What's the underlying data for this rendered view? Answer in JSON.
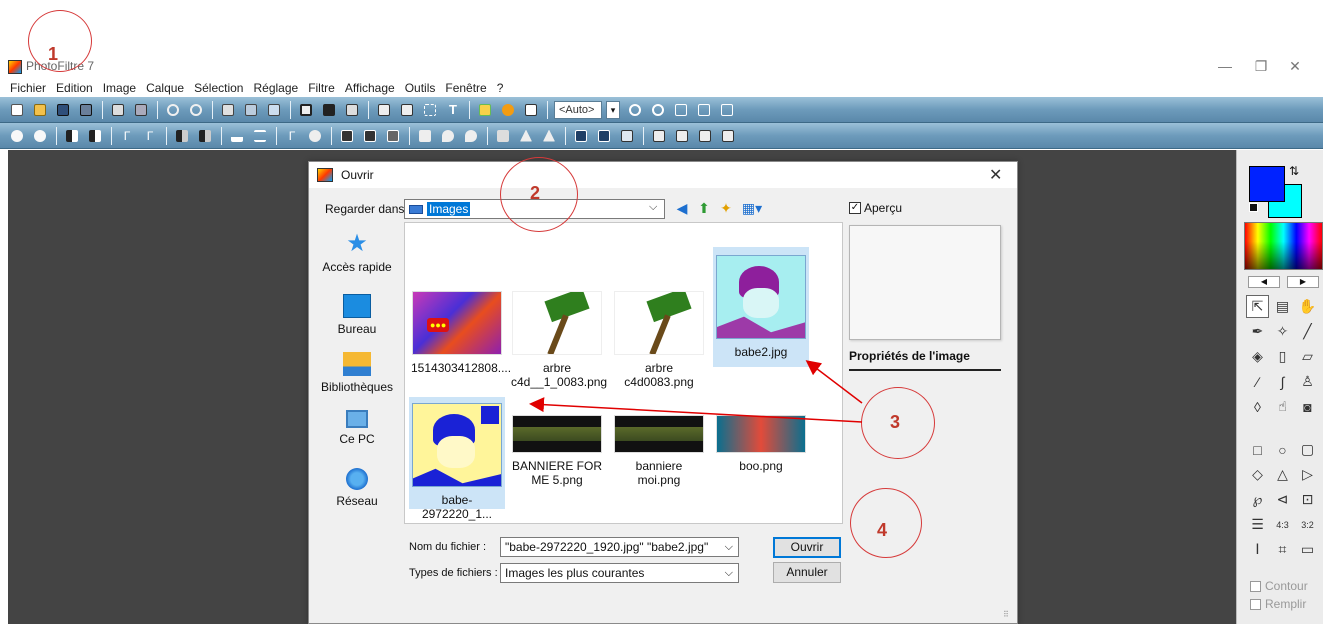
{
  "app": {
    "title": "PhotoFiltre 7",
    "controls": {
      "minimize": "—",
      "restore": "❐",
      "close": "✕"
    }
  },
  "menu": [
    "Fichier",
    "Edition",
    "Image",
    "Calque",
    "Sélection",
    "Réglage",
    "Filtre",
    "Affichage",
    "Outils",
    "Fenêtre",
    "?"
  ],
  "toolbar": {
    "zoom_value": "<Auto>",
    "zoom_drop": "▾"
  },
  "dialog": {
    "title": "Ouvrir",
    "close": "✕",
    "look_in_label": "Regarder dans :",
    "look_in_value": "Images",
    "places": [
      "Accès rapide",
      "Bureau",
      "Bibliothèques",
      "Ce PC",
      "Réseau"
    ],
    "files": [
      {
        "name": "1514303412808....",
        "selected": false,
        "thumb": "poster"
      },
      {
        "name": "arbre c4d__1_0083.png",
        "selected": false,
        "thumb": "tree"
      },
      {
        "name": "arbre c4d0083.png",
        "selected": false,
        "thumb": "tree"
      },
      {
        "name": "babe2.jpg",
        "selected": true,
        "thumb": "babe-purple"
      },
      {
        "name": "babe-2972220_1...",
        "selected": true,
        "thumb": "babe-yellow"
      },
      {
        "name": "BANNIERE FOR ME 5.png",
        "selected": false,
        "thumb": "banner"
      },
      {
        "name": "banniere moi.png",
        "selected": false,
        "thumb": "banner"
      },
      {
        "name": "boo.png",
        "selected": false,
        "thumb": "boo"
      }
    ],
    "preview_label": "Aperçu",
    "preview_checked": "✓",
    "properties_title": "Propriétés de l'image",
    "filename_label": "Nom du fichier :",
    "filename_value": "\"babe-2972220_1920.jpg\" \"babe2.jpg\"",
    "filetype_label": "Types de fichiers :",
    "filetype_value": "Images les plus courantes",
    "open_label": "Ouvrir",
    "cancel_label": "Annuler"
  },
  "tools_panel": {
    "contour_label": "Contour",
    "fill_label": "Remplir",
    "ratio_43": "4:3",
    "ratio_32": "3:2"
  },
  "annotations": [
    "1",
    "2",
    "3",
    "4"
  ],
  "colors": {
    "foreground": "#0022ff",
    "background": "#00ffff",
    "toolbar": "#7aa6c5",
    "workspace": "#444444",
    "annotation": "#d63a3a",
    "selection": "#0078d7"
  }
}
